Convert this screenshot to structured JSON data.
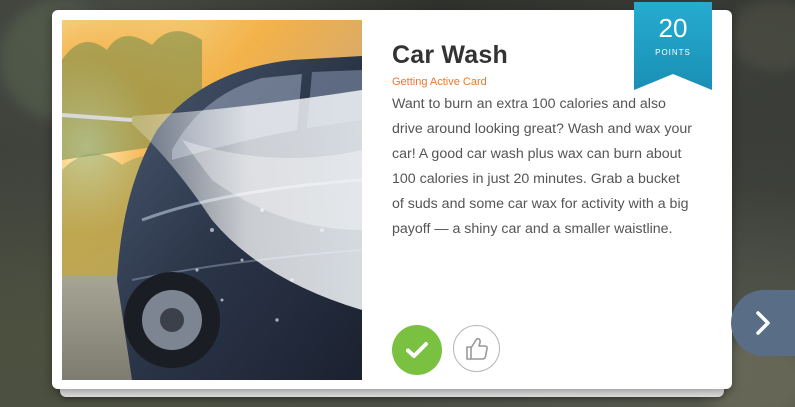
{
  "card": {
    "title": "Car Wash",
    "category": "Getting Active Card",
    "description": "Want to burn an extra 100 calories and also drive around looking great? Wash and wax your car! A good car wash plus wax can burn about 100 calories in just 20 minutes. Grab a bucket of suds and some car wax for activity with a big payoff — a shiny car and a smaller waistline.",
    "image_subject": "person pressure-washing a dark car outdoors",
    "points": {
      "value": "20",
      "label": "POINTS"
    },
    "actions": {
      "done_icon": "checkmark-icon",
      "like_icon": "thumbs-up-icon"
    }
  },
  "navigation": {
    "next_icon": "chevron-right-icon"
  },
  "colors": {
    "accent_orange": "#e8792d",
    "done_green": "#7ac142",
    "ribbon_blue": "#1d9ec4",
    "nav_slate": "#596e86"
  }
}
